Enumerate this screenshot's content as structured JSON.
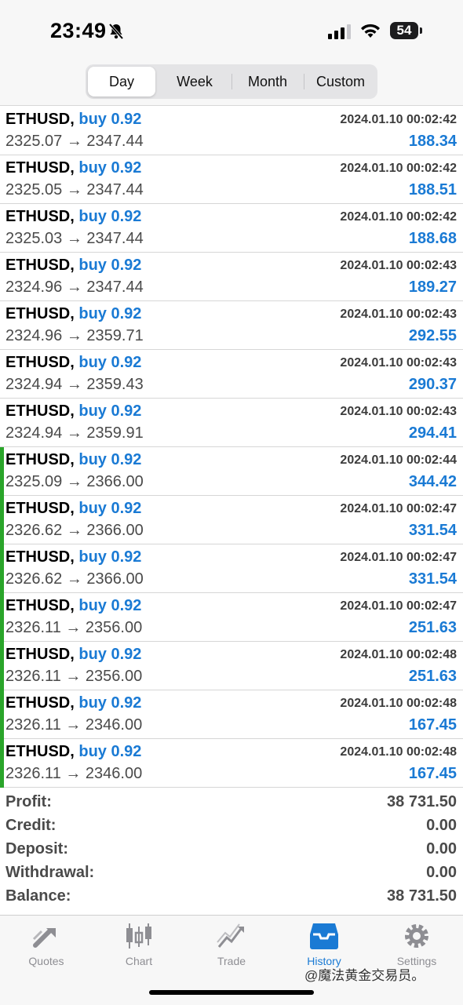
{
  "status_bar": {
    "time": "23:49",
    "battery": "54"
  },
  "segments": [
    {
      "label": "Day",
      "active": true
    },
    {
      "label": "Week",
      "active": false
    },
    {
      "label": "Month",
      "active": false
    },
    {
      "label": "Custom",
      "active": false
    }
  ],
  "trades": [
    {
      "symbol": "ETHUSD,",
      "side": "buy 0.92",
      "time": "2024.01.10 00:02:42",
      "prices": "2325.07 → 2347.44",
      "profit": "188.34",
      "marker": false
    },
    {
      "symbol": "ETHUSD,",
      "side": "buy 0.92",
      "time": "2024.01.10 00:02:42",
      "prices": "2325.05 → 2347.44",
      "profit": "188.51",
      "marker": false
    },
    {
      "symbol": "ETHUSD,",
      "side": "buy 0.92",
      "time": "2024.01.10 00:02:42",
      "prices": "2325.03 → 2347.44",
      "profit": "188.68",
      "marker": false
    },
    {
      "symbol": "ETHUSD,",
      "side": "buy 0.92",
      "time": "2024.01.10 00:02:43",
      "prices": "2324.96 → 2347.44",
      "profit": "189.27",
      "marker": false
    },
    {
      "symbol": "ETHUSD,",
      "side": "buy 0.92",
      "time": "2024.01.10 00:02:43",
      "prices": "2324.96 → 2359.71",
      "profit": "292.55",
      "marker": false
    },
    {
      "symbol": "ETHUSD,",
      "side": "buy 0.92",
      "time": "2024.01.10 00:02:43",
      "prices": "2324.94 → 2359.43",
      "profit": "290.37",
      "marker": false
    },
    {
      "symbol": "ETHUSD,",
      "side": "buy 0.92",
      "time": "2024.01.10 00:02:43",
      "prices": "2324.94 → 2359.91",
      "profit": "294.41",
      "marker": false
    },
    {
      "symbol": "ETHUSD,",
      "side": "buy 0.92",
      "time": "2024.01.10 00:02:44",
      "prices": "2325.09 → 2366.00",
      "profit": "344.42",
      "marker": true
    },
    {
      "symbol": "ETHUSD,",
      "side": "buy 0.92",
      "time": "2024.01.10 00:02:47",
      "prices": "2326.62 → 2366.00",
      "profit": "331.54",
      "marker": true
    },
    {
      "symbol": "ETHUSD,",
      "side": "buy 0.92",
      "time": "2024.01.10 00:02:47",
      "prices": "2326.62 → 2366.00",
      "profit": "331.54",
      "marker": true
    },
    {
      "symbol": "ETHUSD,",
      "side": "buy 0.92",
      "time": "2024.01.10 00:02:47",
      "prices": "2326.11 → 2356.00",
      "profit": "251.63",
      "marker": true
    },
    {
      "symbol": "ETHUSD,",
      "side": "buy 0.92",
      "time": "2024.01.10 00:02:48",
      "prices": "2326.11 → 2356.00",
      "profit": "251.63",
      "marker": true
    },
    {
      "symbol": "ETHUSD,",
      "side": "buy 0.92",
      "time": "2024.01.10 00:02:48",
      "prices": "2326.11 → 2346.00",
      "profit": "167.45",
      "marker": true
    },
    {
      "symbol": "ETHUSD,",
      "side": "buy 0.92",
      "time": "2024.01.10 00:02:48",
      "prices": "2326.11 → 2346.00",
      "profit": "167.45",
      "marker": true
    }
  ],
  "summary": [
    {
      "label": "Profit:",
      "value": "38 731.50"
    },
    {
      "label": "Credit:",
      "value": "0.00"
    },
    {
      "label": "Deposit:",
      "value": "0.00"
    },
    {
      "label": "Withdrawal:",
      "value": "0.00"
    },
    {
      "label": "Balance:",
      "value": "38 731.50"
    }
  ],
  "tabs": [
    {
      "label": "Quotes",
      "icon": "quotes-icon",
      "active": false
    },
    {
      "label": "Chart",
      "icon": "chart-icon",
      "active": false
    },
    {
      "label": "Trade",
      "icon": "trade-icon",
      "active": false
    },
    {
      "label": "History",
      "icon": "history-icon",
      "active": true
    },
    {
      "label": "Settings",
      "icon": "settings-icon",
      "active": false
    }
  ],
  "watermark": "@魔法黄金交易员。",
  "colors": {
    "accent": "#1a7ad4",
    "marker": "#2aa52a",
    "inactive_tab": "#8e8e93"
  }
}
